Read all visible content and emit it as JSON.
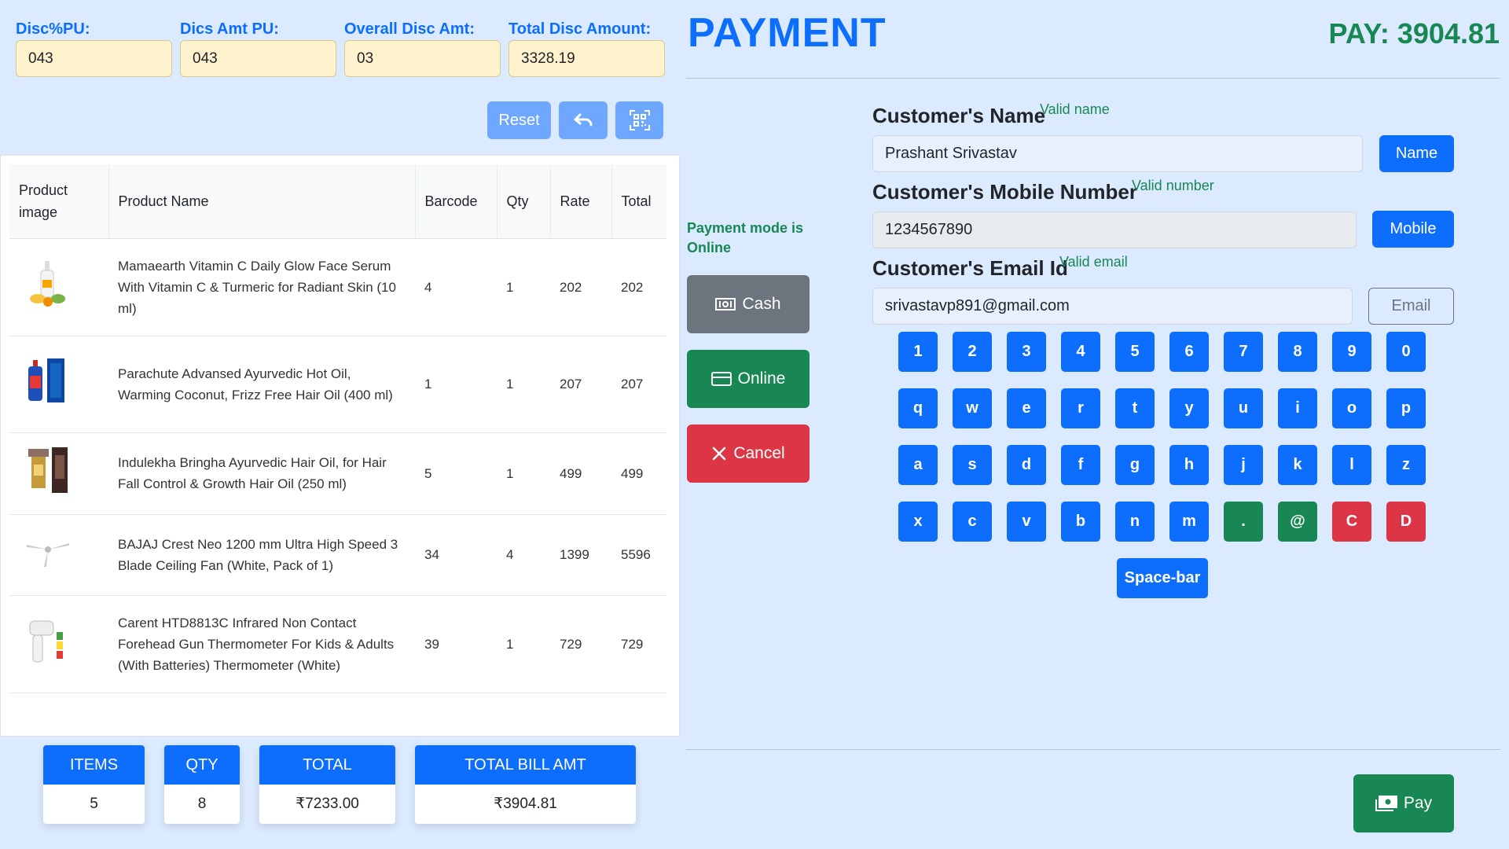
{
  "discounts": {
    "disc_pu_label": "Disc%PU:",
    "disc_pu_value": "043",
    "disc_amt_label": "Dics Amt PU:",
    "disc_amt_value": "043",
    "overall_label": "Overall Disc Amt:",
    "overall_value": "03",
    "total_label": "Total Disc Amount:",
    "total_value": "3328.19"
  },
  "toolbar": {
    "reset_label": "Reset",
    "undo_icon": "undo-icon",
    "qr_icon": "qr-scan-icon"
  },
  "table": {
    "headers": [
      "Product image",
      "Product Name",
      "Barcode",
      "Qty",
      "Rate",
      "Total"
    ],
    "rows": [
      {
        "name": "Mamaearth Vitamin C Daily Glow Face Serum With Vitamin C & Turmeric for Radiant Skin (10 ml)",
        "barcode": "4",
        "qty": "1",
        "rate": "202",
        "total": "202"
      },
      {
        "name": "Parachute Advansed Ayurvedic Hot Oil, Warming Coconut, Frizz Free Hair Oil (400 ml)",
        "barcode": "1",
        "qty": "1",
        "rate": "207",
        "total": "207"
      },
      {
        "name": "Indulekha Bringha Ayurvedic Hair Oil, for Hair Fall Control & Growth Hair Oil (250 ml)",
        "barcode": "5",
        "qty": "1",
        "rate": "499",
        "total": "499"
      },
      {
        "name": "BAJAJ Crest Neo 1200 mm Ultra High Speed 3 Blade Ceiling Fan (White, Pack of 1)",
        "barcode": "34",
        "qty": "4",
        "rate": "1399",
        "total": "5596"
      },
      {
        "name": "Carent HTD8813C Infrared Non Contact Forehead Gun Thermometer For Kids & Adults (With Batteries) Thermometer (White)",
        "barcode": "39",
        "qty": "1",
        "rate": "729",
        "total": "729"
      }
    ]
  },
  "summary": {
    "items_label": "ITEMS",
    "items_value": "5",
    "qty_label": "QTY",
    "qty_value": "8",
    "total_label": "TOTAL",
    "total_value": "₹7233.00",
    "bill_label": "TOTAL BILL AMT",
    "bill_value": "₹3904.81"
  },
  "payment": {
    "title": "PAYMENT",
    "pay_amount": "PAY: 3904.81",
    "mode_message": "Payment mode is Online",
    "cash_label": "Cash",
    "online_label": "Online",
    "cancel_label": "Cancel",
    "pay_label": "Pay"
  },
  "customer": {
    "name_label": "Customer's Name",
    "name_valid": "Valid name",
    "name_value": "Prashant Srivastav",
    "name_button": "Name",
    "mobile_label": "Customer's Mobile Number",
    "mobile_valid": "Valid number",
    "mobile_value": "1234567890",
    "mobile_button": "Mobile",
    "email_label": "Customer's Email Id",
    "email_valid": "Valid email",
    "email_value": "srivastavp891@gmail.com",
    "email_button": "Email"
  },
  "keyboard": {
    "rows": [
      [
        "1",
        "2",
        "3",
        "4",
        "5",
        "6",
        "7",
        "8",
        "9",
        "0"
      ],
      [
        "q",
        "w",
        "e",
        "r",
        "t",
        "y",
        "u",
        "i",
        "o",
        "p"
      ],
      [
        "a",
        "s",
        "d",
        "f",
        "g",
        "h",
        "j",
        "k",
        "l",
        "z"
      ],
      [
        "x",
        "c",
        "v",
        "b",
        "n",
        "m",
        ".",
        "@",
        "C",
        "D"
      ]
    ],
    "space_label": "Space-bar"
  },
  "colors": {
    "primary": "#0d6efd",
    "success": "#198754",
    "danger": "#dc3545",
    "secondary": "#6c757d",
    "background": "#dbeafe",
    "disc_input_bg": "#fff3cd"
  }
}
